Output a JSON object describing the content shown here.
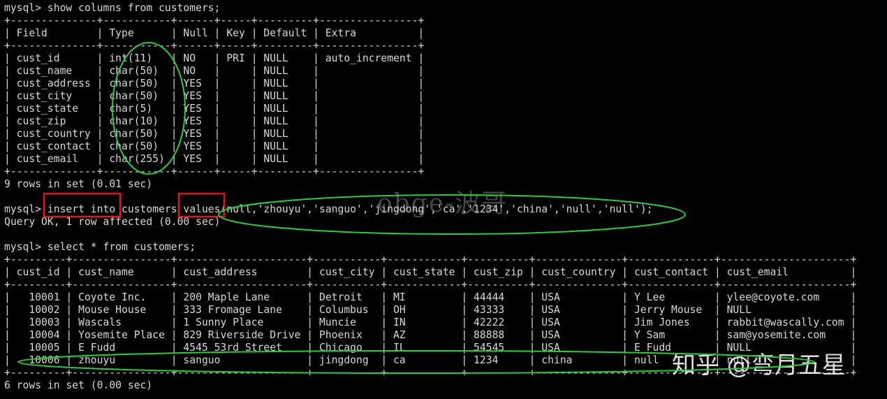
{
  "terminal": {
    "top_partial": "                                                                          -",
    "lines": [
      "mysql> show columns from customers;",
      "+--------------+-----------+------+-----+---------+----------------+",
      "| Field        | Type      | Null | Key | Default | Extra          |",
      "+--------------+-----------+------+-----+---------+----------------+",
      "| cust_id      | int(11)   | NO   | PRI | NULL    | auto_increment |",
      "| cust_name    | char(50)  | NO   |     | NULL    |                |",
      "| cust_address | char(50)  | YES  |     | NULL    |                |",
      "| cust_city    | char(50)  | YES  |     | NULL    |                |",
      "| cust_state   | char(5)   | YES  |     | NULL    |                |",
      "| cust_zip     | char(10)  | YES  |     | NULL    |                |",
      "| cust_country | char(50)  | YES  |     | NULL    |                |",
      "| cust_contact | char(50)  | YES  |     | NULL    |                |",
      "| cust_email   | char(255) | YES  |     | NULL    |                |",
      "+--------------+-----------+------+-----+---------+----------------+",
      "9 rows in set (0.01 sec)",
      "",
      "mysql> insert into customers values(null,'zhouyu','sanguo','jingdong','ca','1234','china','null','null');",
      "Query OK, 1 row affected (0.00 sec)",
      "",
      "mysql> select * from customers;",
      "+---------+----------------+---------------------+-----------+------------+----------+--------------+--------------+---------------------+",
      "| cust_id | cust_name      | cust_address        | cust_city | cust_state | cust_zip | cust_country | cust_contact | cust_email          |",
      "+---------+----------------+---------------------+-----------+------------+----------+--------------+--------------+---------------------+",
      "|   10001 | Coyote Inc.    | 200 Maple Lane      | Detroit   | MI         | 44444    | USA          | Y Lee        | ylee@coyote.com     |",
      "|   10002 | Mouse House    | 333 Fromage Lane    | Columbus  | OH         | 43333    | USA          | Jerry Mouse  | NULL                |",
      "|   10003 | Wascals        | 1 Sunny Place       | Muncie    | IN         | 42222    | USA          | Jim Jones    | rabbit@wascally.com |",
      "|   10004 | Yosemite Place | 829 Riverside Drive | Phoenix   | AZ         | 88888    | USA          | Y Sam        | sam@yosemite.com    |",
      "|   10005 | E Fudd         | 4545 53rd Street    | Chicago   | IL         | 54545    | USA          | E Fudd       | NULL                |",
      "|   10006 | zhouyu         | sanguo              | jingdong  | ca         | 1234     | china        | null         | null                |",
      "+---------+----------------+---------------------+-----------+------------+----------+--------------+--------------+---------------------+",
      "6 rows in set (0.00 sec)"
    ]
  },
  "watermarks": {
    "center": "obge-波哥",
    "corner": "知乎 @弯月五星"
  },
  "colors": {
    "background": "#000000",
    "text": "#d8d8d8",
    "highlight_box": "#e01818",
    "highlight_ellipse": "#22d03a"
  }
}
